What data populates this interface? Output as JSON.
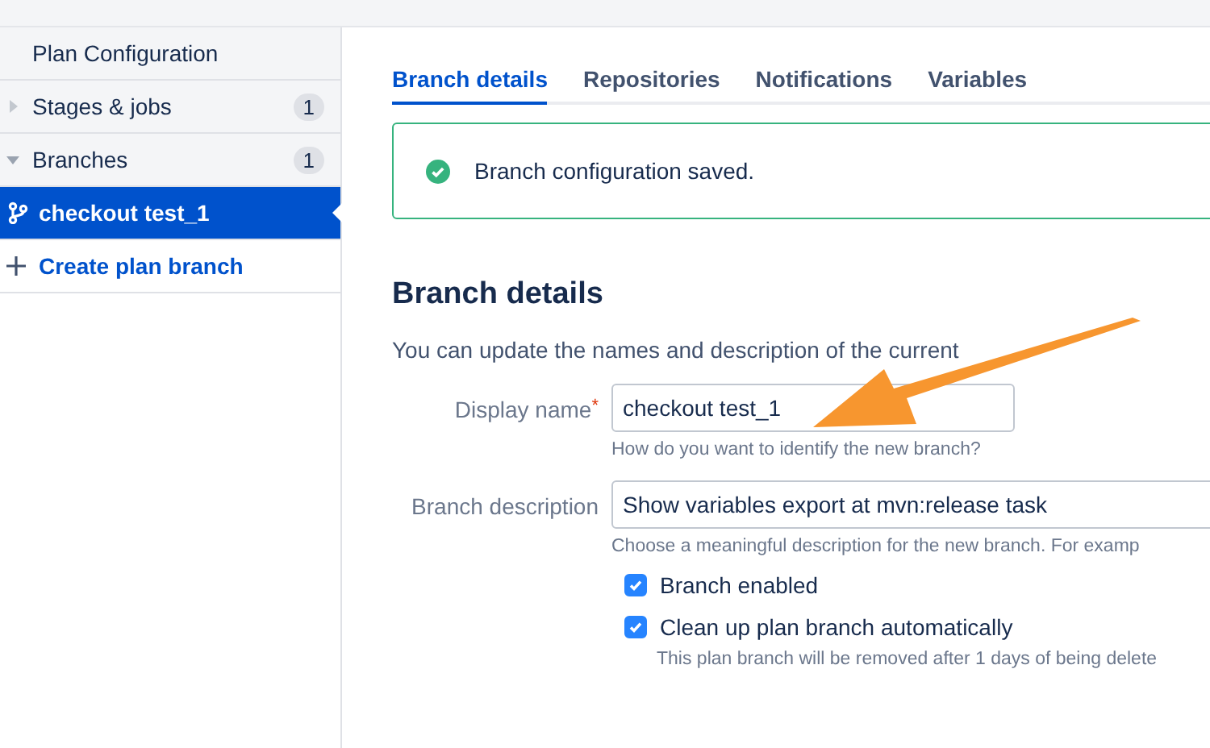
{
  "sidebar": {
    "title": "Plan Configuration",
    "items": [
      {
        "label": "Stages & jobs",
        "count": "1",
        "kind": "group",
        "expanded": false,
        "selected": false
      },
      {
        "label": "Branches",
        "count": "1",
        "kind": "group",
        "expanded": true,
        "selected": false
      },
      {
        "label": "checkout test_1",
        "kind": "branch",
        "selected": true
      },
      {
        "label": "Create plan branch",
        "kind": "action",
        "selected": false
      }
    ]
  },
  "tabs": [
    {
      "label": "Branch details",
      "selected": true
    },
    {
      "label": "Repositories",
      "selected": false
    },
    {
      "label": "Notifications",
      "selected": false
    },
    {
      "label": "Variables",
      "selected": false
    }
  ],
  "alert": {
    "message": "Branch configuration saved."
  },
  "section": {
    "title": "Branch details",
    "description": "You can update the names and description of the current"
  },
  "fields": [
    {
      "label": "Display name",
      "required_mark": "*",
      "value": "checkout test_1",
      "help": "How do you want to identify the new branch?",
      "wide": false
    },
    {
      "label": "Branch description",
      "value": "Show variables export at mvn:release task",
      "help": "Choose a meaningful description for the new branch. For examp",
      "wide": true
    }
  ],
  "checkboxes": [
    {
      "label": "Branch enabled",
      "checked": true
    },
    {
      "label": "Clean up plan branch automatically",
      "checked": true,
      "help": "This plan branch will be removed after 1 days of being delete"
    }
  ]
}
